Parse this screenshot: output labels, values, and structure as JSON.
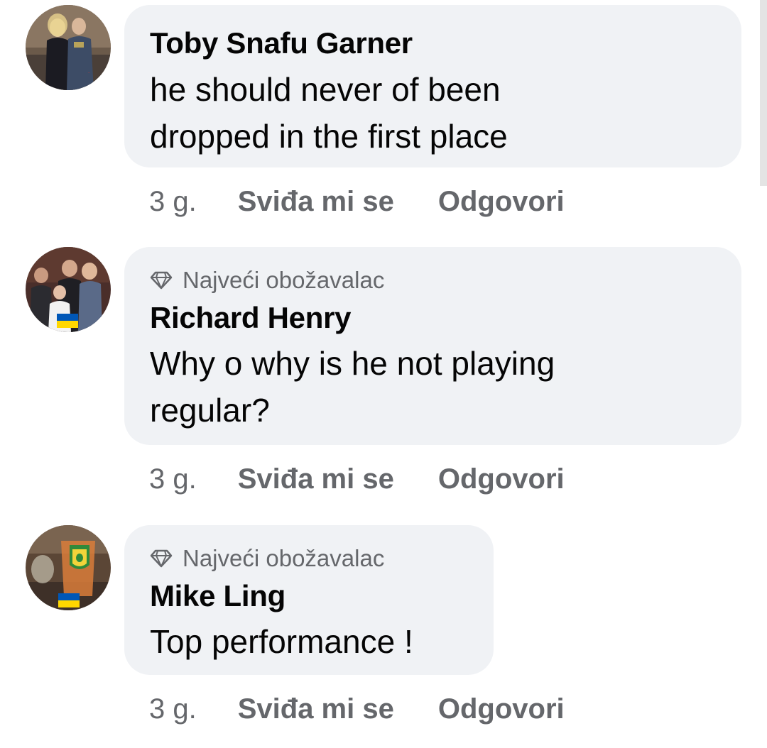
{
  "comments": [
    {
      "author": "Toby Snafu Garner",
      "badge": "",
      "text_lines": [
        "he should never of been",
        "dropped in the first place"
      ],
      "time": "3 g.",
      "like_label": "Sviđa mi se",
      "reply_label": "Odgovori"
    },
    {
      "author": "Richard Henry",
      "badge": "Najveći obožavalac",
      "badge_icon": "diamond-icon",
      "text_lines": [
        "Why o why is he not playing",
        "regular?"
      ],
      "time": "3 g.",
      "like_label": "Sviđa mi se",
      "reply_label": "Odgovori"
    },
    {
      "author": "Mike Ling",
      "badge": "Najveći obožavalac",
      "badge_icon": "diamond-icon",
      "text_lines": [
        "Top performance !"
      ],
      "time": "3 g.",
      "like_label": "Sviđa mi se",
      "reply_label": "Odgovori"
    }
  ],
  "colors": {
    "bubble": "#f0f2f5",
    "secondary_text": "#65676b",
    "primary_text": "#050505",
    "ukraine_blue": "#0057b7",
    "ukraine_yellow": "#ffd700"
  }
}
